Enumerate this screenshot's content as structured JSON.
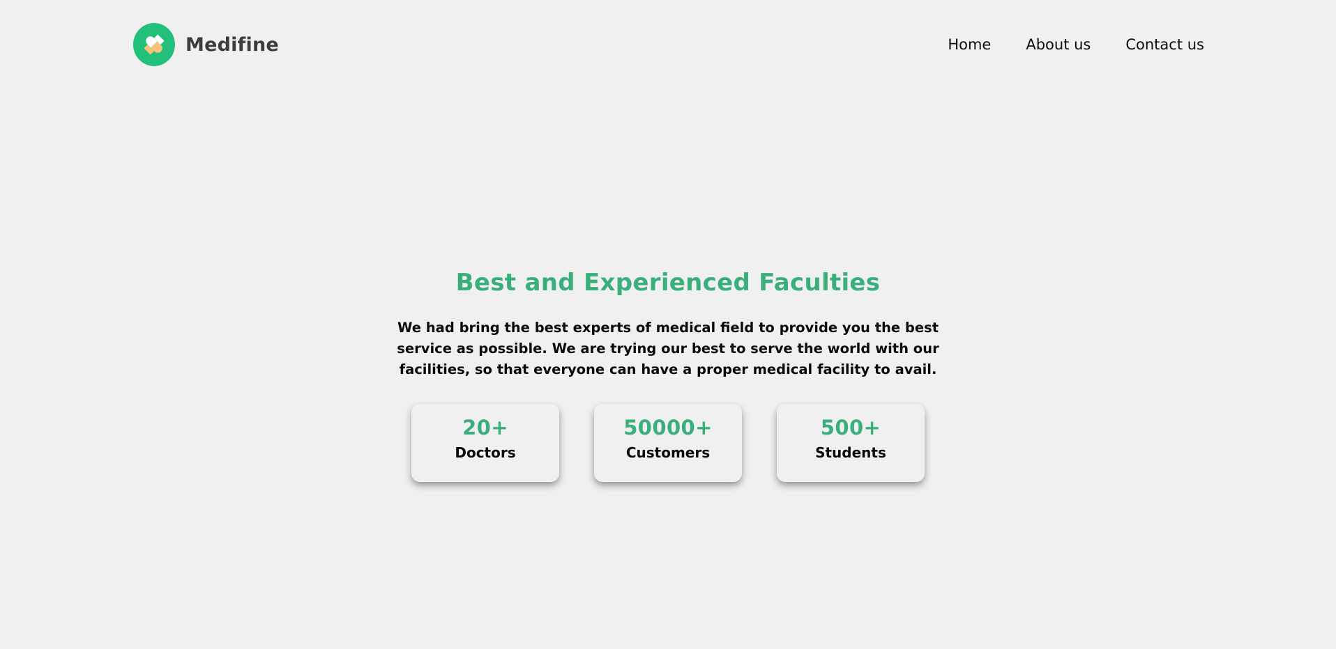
{
  "header": {
    "brand_name": "Medifine",
    "nav": [
      {
        "label": "Home"
      },
      {
        "label": "About us"
      },
      {
        "label": "Contact us"
      }
    ]
  },
  "hero": {
    "title": "Best and Experienced Faculties",
    "description": "We had bring the best experts of medical field to provide you the best service as possible. We are trying our best to serve the world with our facilities, so that everyone can have a proper medical facility to avail."
  },
  "stats": [
    {
      "value": "20+",
      "label": "Doctors"
    },
    {
      "value": "50000+",
      "label": "Customers"
    },
    {
      "value": "500+",
      "label": "Students"
    }
  ],
  "colors": {
    "background": "#f0f0f0",
    "brand_green": "#23c07c",
    "accent_green": "#3aaf7b",
    "pill_orange": "#f7c27a",
    "text": "#0b0b0b"
  },
  "icons": {
    "brand": "pill-icon"
  }
}
